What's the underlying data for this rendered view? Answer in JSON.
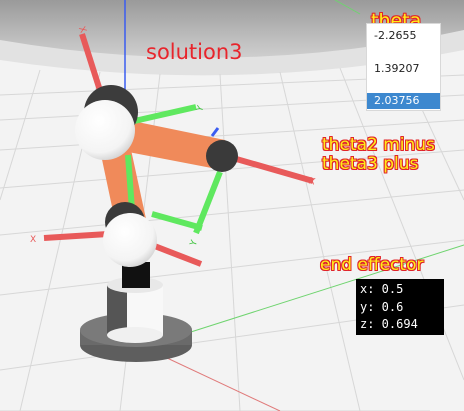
{
  "scene": {
    "name": "robot-arm-viewport",
    "axis_labels": {
      "base_x": "X",
      "shoulder_x": "X",
      "shoulder_y": "Y",
      "elbow_x": "X",
      "elbow_y": "Y",
      "lower_y": "Y"
    },
    "colors": {
      "link_orange": "#f08a5a",
      "axis_red": "#e85a5a",
      "axis_green": "#5fe85f",
      "axis_blue": "#3a5cf0",
      "joint_dark": "#3a3a3a",
      "base_gray": "#707070",
      "floor": "#f2f2f2",
      "grid": "#d6d6d6"
    }
  },
  "theta_panel": {
    "title": "theta",
    "values": [
      "-2.2655",
      "1.39207",
      "2.03756"
    ],
    "selected_index": 2,
    "selected_color": "#3d88cf"
  },
  "solution_label": "solution3",
  "theta2_label": {
    "line1": "theta2 minus",
    "line2": "theta3 plus"
  },
  "end_effector": {
    "title": "end effector",
    "x": "x: 0.5",
    "y": "y: 0.6",
    "z": "z: 0.694"
  }
}
